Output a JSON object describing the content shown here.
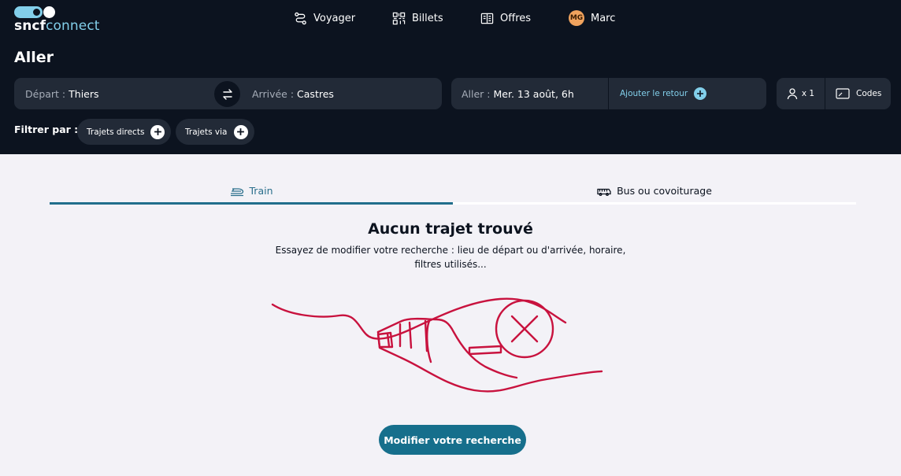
{
  "brand": {
    "part1": "sncf",
    "part2": "connect"
  },
  "nav": [
    {
      "label": "Voyager",
      "icon": "route-icon"
    },
    {
      "label": "Billets",
      "icon": "qr-code-icon"
    },
    {
      "label": "Offres",
      "icon": "offers-book-icon"
    }
  ],
  "user": {
    "initials": "MG",
    "name": "Marc"
  },
  "page_title": "Aller",
  "search": {
    "departure_label": "Départ :",
    "departure_value": "Thiers",
    "arrival_label": "Arrivée :",
    "arrival_value": "Castres",
    "outbound_label": "Aller :",
    "outbound_value": "Mer. 13 août, 6h",
    "add_return": "Ajouter le retour",
    "passengers": "x 1",
    "codes": "Codes"
  },
  "filters": {
    "label": "Filtrer par :",
    "chips": [
      "Trajets directs",
      "Trajets via"
    ]
  },
  "tabs": [
    {
      "label": "Train",
      "active": true
    },
    {
      "label": "Bus ou covoiturage",
      "active": false
    }
  ],
  "empty_state": {
    "title": "Aucun trajet trouvé",
    "text": "Essayez de modifier votre recherche : lieu de départ ou d'arrivée, horaire, filtres utilisés..."
  },
  "cta": "Modifier votre recherche",
  "colors": {
    "header_bg": "#0c131f",
    "field_bg": "#222a37",
    "accent_light": "#82cfea",
    "accent": "#166f8c",
    "illustration": "#c8123e"
  }
}
